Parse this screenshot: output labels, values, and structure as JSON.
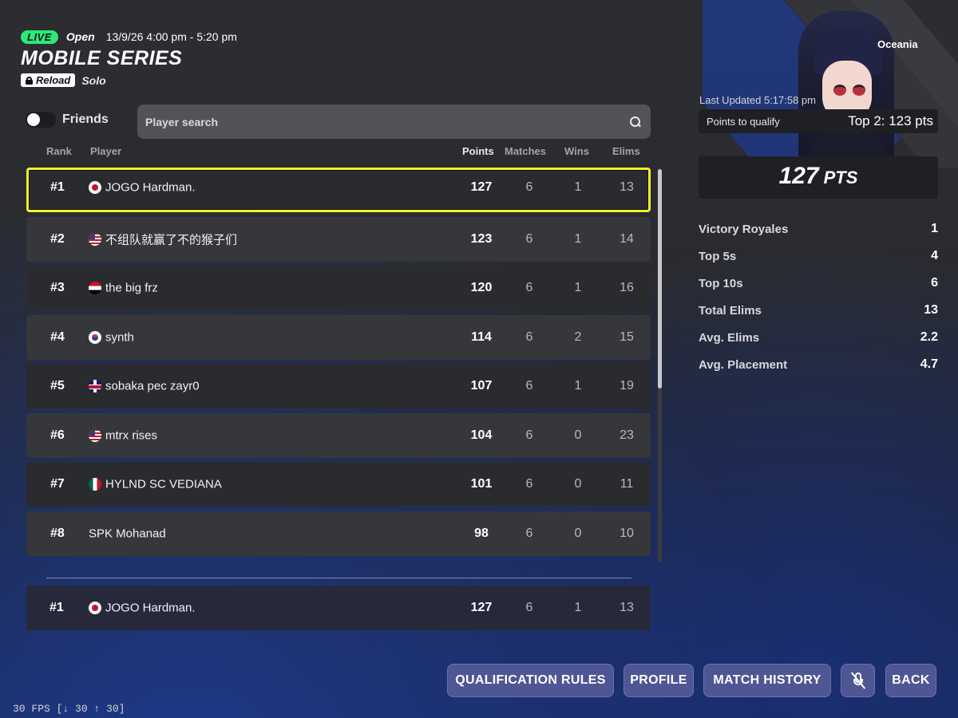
{
  "header": {
    "live_label": "LIVE",
    "status": "Open",
    "time_range": "13/9/26 4:00 pm - 5:20 pm",
    "title": "MOBILE SERIES",
    "mode_badge": "Reload",
    "mode_type": "Solo"
  },
  "filters": {
    "friends_label": "Friends",
    "friends_enabled": false,
    "search_placeholder": "Player search"
  },
  "columns": {
    "rank": "Rank",
    "player": "Player",
    "points": "Points",
    "matches": "Matches",
    "wins": "Wins",
    "elims": "Elims"
  },
  "leaderboard": [
    {
      "rank": "#1",
      "flag": "jp",
      "name": "JOGO Hardman.",
      "points": "127",
      "matches": "6",
      "wins": "1",
      "elims": "13"
    },
    {
      "rank": "#2",
      "flag": "us",
      "name": "不组队就赢了不的猴子们",
      "points": "123",
      "matches": "6",
      "wins": "1",
      "elims": "14"
    },
    {
      "rank": "#3",
      "flag": "eg",
      "name": "the big frz",
      "points": "120",
      "matches": "6",
      "wins": "1",
      "elims": "16"
    },
    {
      "rank": "#4",
      "flag": "kr",
      "name": "synth",
      "points": "114",
      "matches": "6",
      "wins": "2",
      "elims": "15"
    },
    {
      "rank": "#5",
      "flag": "gb",
      "name": "sobaka pec zayr0",
      "points": "107",
      "matches": "6",
      "wins": "1",
      "elims": "19"
    },
    {
      "rank": "#6",
      "flag": "us",
      "name": "mtrx rises",
      "points": "104",
      "matches": "6",
      "wins": "0",
      "elims": "23"
    },
    {
      "rank": "#7",
      "flag": "mx",
      "name": "HYLND SC VEDIANA",
      "points": "101",
      "matches": "6",
      "wins": "0",
      "elims": "11"
    },
    {
      "rank": "#8",
      "flag": "",
      "name": "SPK Mohanad",
      "points": "98",
      "matches": "6",
      "wins": "0",
      "elims": "10"
    }
  ],
  "self_row": {
    "rank": "#1",
    "flag": "jp",
    "name": "JOGO Hardman.",
    "points": "127",
    "matches": "6",
    "wins": "1",
    "elims": "13"
  },
  "profile": {
    "region": "Oceania",
    "last_updated": "Last Updated 5:17:58 pm",
    "qualify_label": "Points to qualify",
    "qualify_value": "Top 2: 123 pts",
    "total_points": "127",
    "points_unit": "PTS",
    "stats": [
      {
        "label": "Victory Royales",
        "value": "1"
      },
      {
        "label": "Top 5s",
        "value": "4"
      },
      {
        "label": "Top 10s",
        "value": "6"
      },
      {
        "label": "Total Elims",
        "value": "13"
      },
      {
        "label": "Avg. Elims",
        "value": "2.2"
      },
      {
        "label": "Avg. Placement",
        "value": "4.7"
      }
    ]
  },
  "buttons": {
    "qualification_rules": "QUALIFICATION RULES",
    "profile": "PROFILE",
    "match_history": "MATCH HISTORY",
    "back": "BACK"
  },
  "fps": "30 FPS [↓ 30 ↑ 30]",
  "colors": {
    "live_green": "#2ee87a",
    "selected_outline": "#f2f227",
    "button_blue": "#4e5694"
  }
}
